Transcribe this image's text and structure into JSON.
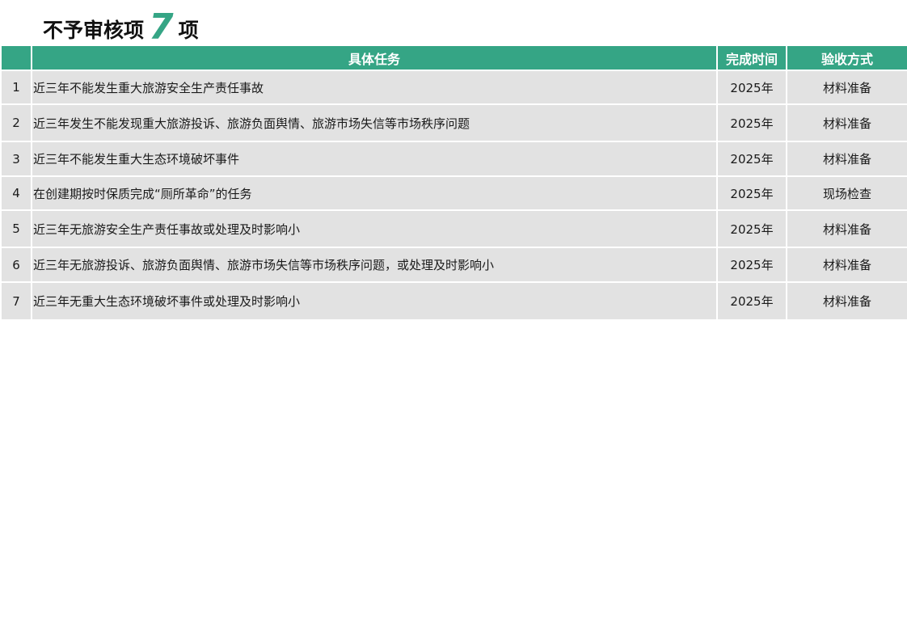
{
  "title": {
    "prefix": "不予审核项",
    "count": "7",
    "suffix": "项"
  },
  "table": {
    "headers": {
      "index": "",
      "task": "具体任务",
      "time": "完成时间",
      "method": "验收方式"
    },
    "rows": [
      {
        "index": "1",
        "task": "近三年不能发生重大旅游安全生产责任事故",
        "time": "2025年",
        "method": "材料准备"
      },
      {
        "index": "2",
        "task": "近三年发生不能发现重大旅游投诉、旅游负面舆情、旅游市场失信等市场秩序问题",
        "time": "2025年",
        "method": "材料准备"
      },
      {
        "index": "3",
        "task": "近三年不能发生重大生态环境破坏事件",
        "time": "2025年",
        "method": "材料准备"
      },
      {
        "index": "4",
        "task": "在创建期按时保质完成“厕所革命”的任务",
        "time": "2025年",
        "method": "现场检查"
      },
      {
        "index": "5",
        "task": "近三年无旅游安全生产责任事故或处理及时影响小",
        "time": "2025年",
        "method": "材料准备"
      },
      {
        "index": "6",
        "task": "近三年无旅游投诉、旅游负面舆情、旅游市场失信等市场秩序问题，或处理及时影响小",
        "time": "2025年",
        "method": "材料准备"
      },
      {
        "index": "7",
        "task": "近三年无重大生态环境破坏事件或处理及时影响小",
        "time": "2025年",
        "method": "材料准备"
      }
    ]
  },
  "colors": {
    "header_bg": "#35a585",
    "row_bg": "#e2e2e2",
    "accent": "#35a585"
  }
}
